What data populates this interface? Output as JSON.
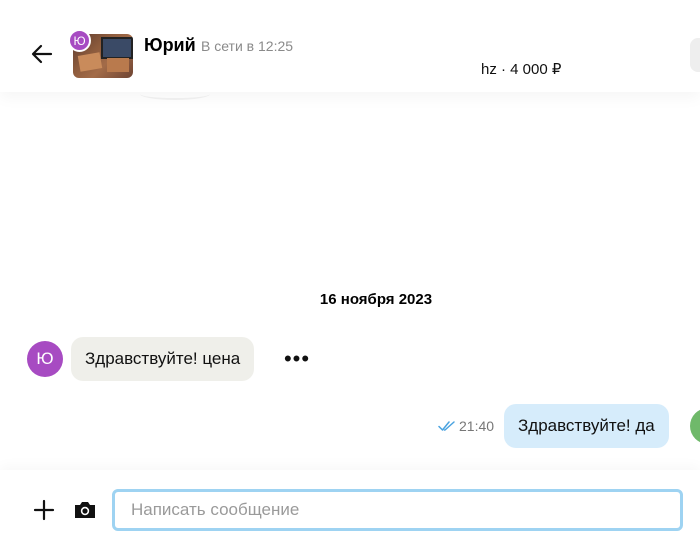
{
  "header": {
    "user_initial": "Ю",
    "user_name": "Юрий",
    "status": "В сети в 12:25",
    "item_info": "hz · 4 000 ₽"
  },
  "chat": {
    "date": "16 ноября 2023",
    "messages": [
      {
        "direction": "incoming",
        "avatar_initial": "Ю",
        "text": "Здравствуйте! цена"
      },
      {
        "direction": "outgoing",
        "time": "21:40",
        "text": "Здравствуйте! да",
        "status": "read"
      }
    ],
    "more_label": "•••"
  },
  "composer": {
    "placeholder": "Написать сообщение",
    "value": ""
  },
  "colors": {
    "avatar": "#a74bc2",
    "incoming_bubble": "#efefea",
    "outgoing_bubble": "#d6ecfb",
    "input_border": "#9ed3f2",
    "read_check": "#4aa3e0"
  },
  "icons": {
    "back": "arrow-left-icon",
    "more": "more-horizontal-icon",
    "read": "double-check-icon",
    "attach": "plus-icon",
    "camera": "camera-icon"
  }
}
